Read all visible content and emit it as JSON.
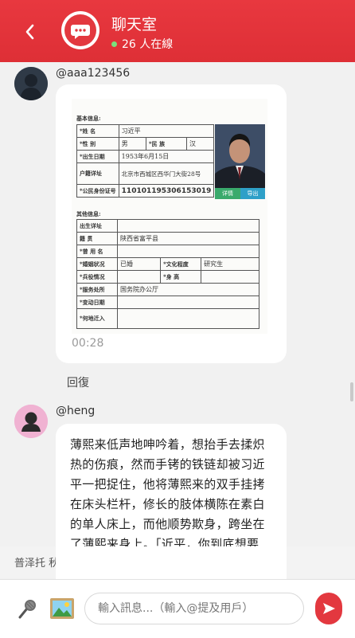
{
  "header": {
    "back_icon": "chevron-left-icon",
    "room_icon": "chat-bubble-icon",
    "title": "聊天室",
    "online_count": "26 人在線",
    "accent_color": "#e3383f"
  },
  "messages": [
    {
      "username": "@aaa123456",
      "avatar_icon": "user-avatar-icon",
      "type": "image",
      "timestamp": "00:28",
      "reply_label": "回復",
      "document": {
        "section_basic": "基本信息:",
        "name_label": "*姓 名",
        "name_value": "习近平",
        "gender_label": "*性 别",
        "gender_value": "男",
        "ethnicity_label": "*民 族",
        "ethnicity_value": "汉",
        "birth_label": "*出生日期",
        "birth_value": "1953年6月15日",
        "address_label": "户籍详址",
        "address_value": "北京市西城区西华门大街28号",
        "id_label": "*公民身份证号",
        "id_value": "110101195306153019",
        "detail_btn": "详情",
        "export_btn": "导出",
        "section_other": "其他信息:",
        "birthplace_label": "出生详址",
        "birthplace_value": "",
        "native_label": "籍 贯",
        "native_value": "陕西省富平县",
        "former_name_label": "*曾 用 名",
        "former_name_value": "",
        "marital_label": "*婚姻状况",
        "marital_value": "已婚",
        "education_label": "*文化程度",
        "education_value": "研究生",
        "military_label": "*兵役情况",
        "military_value": "",
        "height_label": "*身 高",
        "height_value": "",
        "workplace_label": "*服务处所",
        "workplace_value": "国务院办公厅",
        "change_date_label": "*变动日期",
        "change_date_value": "",
        "moved_from_label": "*何地迁入",
        "moved_from_value": ""
      }
    },
    {
      "username": "@heng",
      "avatar_icon": "user-avatar-icon",
      "type": "text",
      "text": "薄熙来低声地呻吟着，想抬手去揉炽热的伤痕，然而手铐的铁链却被习近平一把捉住，他将薄熙来的双手挂拷在床头栏杆，修长的肢体横陈在素白的单人床上，而他顺势欺身，跨坐在了薄熙来身上。「近平，你到底想要什么？」薄熙来痛"
    }
  ],
  "next_user_preview": "普泽托 秋",
  "input_bar": {
    "mic_icon": "microphone-icon",
    "image_icon": "image-picture-icon",
    "placeholder": "輸入訊息...（輸入@提及用戶）",
    "send_icon": "send-arrow-icon"
  }
}
